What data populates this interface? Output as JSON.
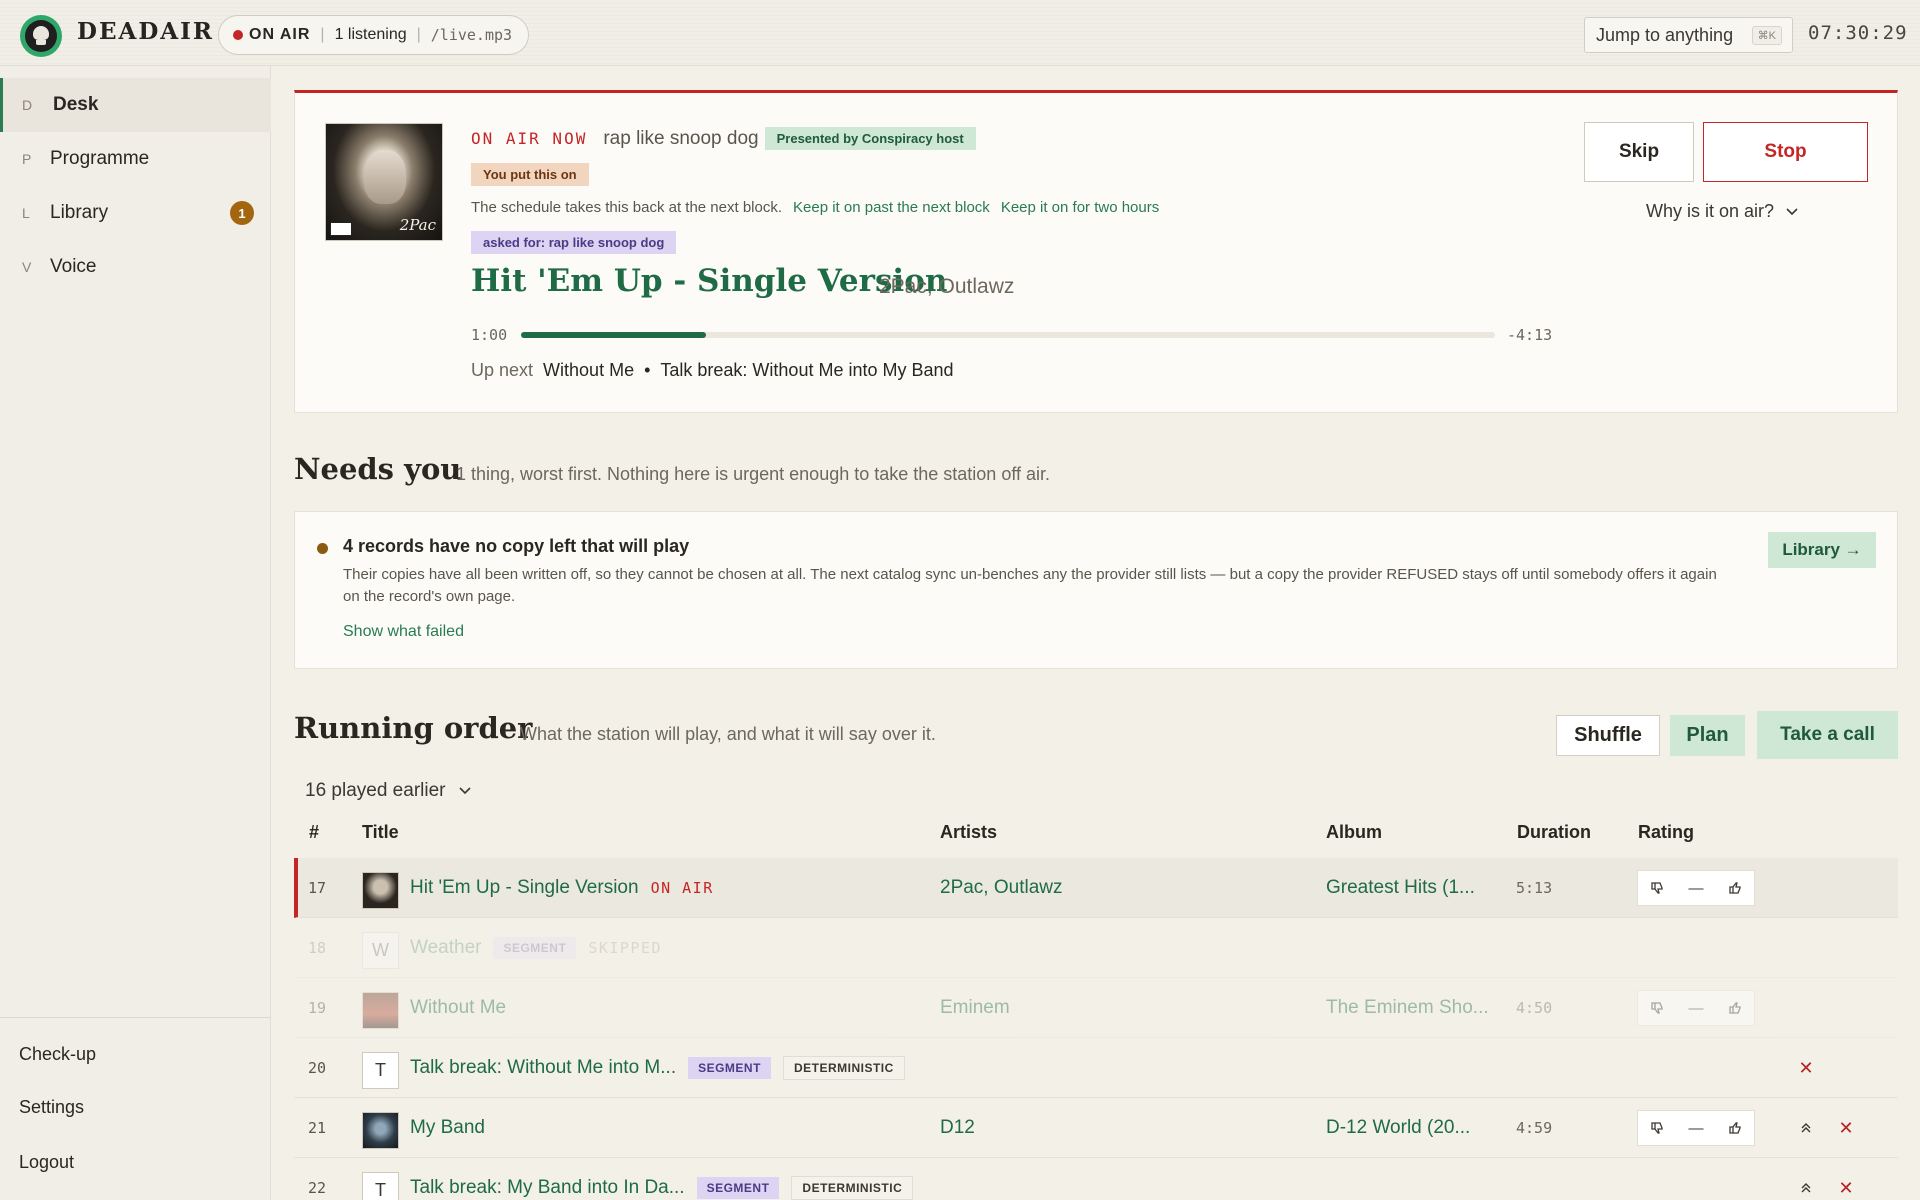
{
  "app": {
    "name": "DEADAIR",
    "status": {
      "on_air": "ON AIR",
      "listeners": "1 listening",
      "stream": "/live.mp3"
    },
    "jump": {
      "placeholder": "Jump to anything",
      "shortcut": "⌘K"
    },
    "clock": "07:30:29"
  },
  "sidebar": {
    "items": [
      {
        "key": "D",
        "label": "Desk",
        "active": true
      },
      {
        "key": "P",
        "label": "Programme"
      },
      {
        "key": "L",
        "label": "Library",
        "badge": "1"
      },
      {
        "key": "V",
        "label": "Voice"
      }
    ],
    "footer": [
      "Check-up",
      "Settings",
      "Logout"
    ]
  },
  "now": {
    "label": "ON AIR NOW",
    "show": "rap like snoop dog",
    "host_chip": "Presented by Conspiracy host",
    "you_chip": "You put this on",
    "schedule_note": "The schedule takes this back at the next block.",
    "keep_next": "Keep it on past the next block",
    "keep_two": "Keep it on for two hours",
    "ask_chip": "asked for: rap like snoop dog",
    "title": "Hit 'Em Up - Single Version",
    "artist": "2Pac, Outlawz",
    "elapsed": "1:00",
    "remaining": "-4:13",
    "progress": 0.19,
    "up_next_label": "Up next",
    "up_next_track": "Without Me",
    "up_next_bullet": "•",
    "up_next_break": "Talk break: Without Me into My Band",
    "skip": "Skip",
    "stop": "Stop",
    "why": "Why is it on air?",
    "cover_tag": "2Pac"
  },
  "needs": {
    "title": "Needs you",
    "subtitle": "1 thing, worst first. Nothing here is urgent enough to take the station off air.",
    "item_title": "4 records have no copy left that will play",
    "item_body": "Their copies have all been written off, so they cannot be chosen at all. The next catalog sync un-benches any the provider still lists — but a copy the provider REFUSED stays off until somebody offers it again on the record's own page.",
    "item_link": "Show what failed",
    "item_action": "Library →"
  },
  "running": {
    "title": "Running order",
    "subtitle": "What the station will play, and what it will say over it.",
    "shuffle": "Shuffle",
    "plan": "Plan",
    "call": "Take a call",
    "played_earlier": "16 played earlier",
    "columns": [
      "#",
      "Title",
      "Artists",
      "Album",
      "Duration",
      "Rating"
    ],
    "rows": [
      {
        "n": "17",
        "title": "Hit 'Em Up - Single Version",
        "tag": "ON AIR",
        "artists": "2Pac, Outlawz",
        "album": "Greatest Hits (1...",
        "duration": "5:13"
      },
      {
        "n": "18",
        "letter": "W",
        "title": "Weather",
        "segment": "SEGMENT",
        "skipped": "SKIPPED"
      },
      {
        "n": "19",
        "title": "Without Me",
        "artists": "Eminem",
        "album": "The Eminem Sho...",
        "duration": "4:50"
      },
      {
        "n": "20",
        "letter": "T",
        "title": "Talk break: Without Me into M...",
        "segment": "SEGMENT",
        "det": "DETERMINISTIC"
      },
      {
        "n": "21",
        "title": "My Band",
        "artists": "D12",
        "album": "D-12 World (20...",
        "duration": "4:59"
      },
      {
        "n": "22",
        "letter": "T",
        "title": "Talk break: My Band into In Da...",
        "segment": "SEGMENT",
        "det": "DETERMINISTIC"
      }
    ],
    "rating": {
      "down": "thumbs-down-icon",
      "neutral": "—",
      "up": "thumbs-up-icon"
    }
  },
  "colors": {
    "accent": "#1f6b46",
    "onair": "#c42626",
    "background": "#f3f0e8"
  }
}
